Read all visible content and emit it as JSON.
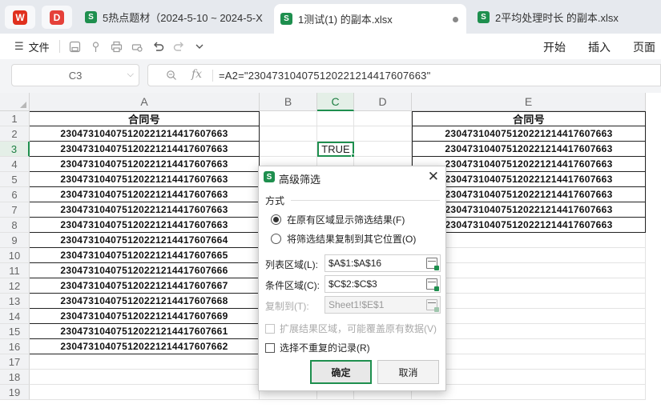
{
  "tabs": [
    {
      "title": "5热点题材（2024-5-10 ~ 2024-5-X)",
      "active": false
    },
    {
      "title": "1测试(1) 的副本.xlsx",
      "active": true
    },
    {
      "title": "2平均处理时长 的副本.xlsx",
      "active": false
    }
  ],
  "app_icons": [
    {
      "name": "wps-logo-icon",
      "glyph": "W",
      "color": "#e0301e"
    },
    {
      "name": "pdf-app-icon",
      "glyph": "D",
      "color": "#e5413a"
    }
  ],
  "toolbar": {
    "menu_icon": "☰",
    "file_label": "文件",
    "right_menus": [
      "开始",
      "插入",
      "页面"
    ]
  },
  "namebox": {
    "value": "C3"
  },
  "formula": {
    "fx": "fx",
    "text": "=A2=\"230473104075120221214417607663\""
  },
  "columns": [
    {
      "label": "A"
    },
    {
      "label": "B"
    },
    {
      "label": "C",
      "selected": true
    },
    {
      "label": "D"
    },
    {
      "label": "E"
    }
  ],
  "rows": [
    "1",
    "2",
    "3",
    "4",
    "5",
    "6",
    "7",
    "8",
    "9",
    "10",
    "11",
    "12",
    "13",
    "14",
    "15",
    "16",
    "17",
    "18",
    "19"
  ],
  "column_a": {
    "header": "合同号",
    "values": [
      "230473104075120221214417607663",
      "230473104075120221214417607663",
      "230473104075120221214417607663",
      "230473104075120221214417607663",
      "230473104075120221214417607663",
      "230473104075120221214417607663",
      "230473104075120221214417607663",
      "230473104075120221214417607664",
      "230473104075120221214417607665",
      "230473104075120221214417607666",
      "230473104075120221214417607667",
      "230473104075120221214417607668",
      "230473104075120221214417607669",
      "230473104075120221214417607661",
      "230473104075120221214417607662"
    ]
  },
  "column_c": {
    "c3": "TRUE"
  },
  "column_e": {
    "header": "合同号",
    "values": [
      "230473104075120221214417607663",
      "230473104075120221214417607663",
      "230473104075120221214417607663",
      "230473104075120221214417607663",
      "230473104075120221214417607663",
      "230473104075120221214417607663",
      "230473104075120221214417607663"
    ]
  },
  "dialog": {
    "title": "高级筛选",
    "close": "✕",
    "section": "方式",
    "radio_in_place": "在原有区域显示筛选结果(F)",
    "radio_copy": "将筛选结果复制到其它位置(O)",
    "list_range_label": "列表区域(L):",
    "list_range_value": "$A$1:$A$16",
    "criteria_label": "条件区域(C):",
    "criteria_value": "$C$2:$C$3",
    "copy_to_label": "复制到(T):",
    "copy_to_value": "Sheet1!$E$1",
    "expand_label": "扩展结果区域，可能覆盖原有数据(V)",
    "unique_label": "选择不重复的记录(R)",
    "ok": "确定",
    "cancel": "取消"
  }
}
